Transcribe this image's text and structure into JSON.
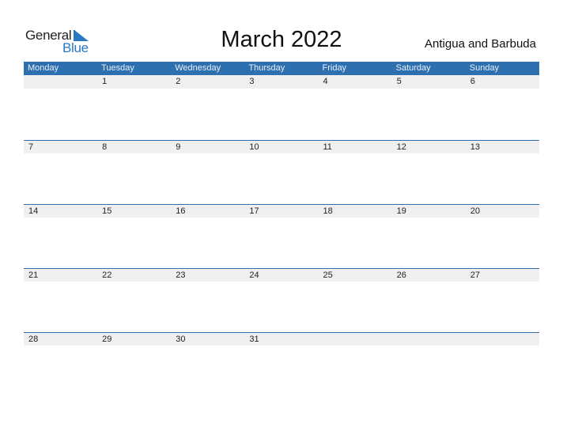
{
  "logo": {
    "general": "General",
    "blue": "Blue"
  },
  "title": "March 2022",
  "country": "Antigua and Barbuda",
  "colors": {
    "accent": "#2e6fb0",
    "band": "#f0f0f0"
  },
  "weekdays": [
    "Monday",
    "Tuesday",
    "Wednesday",
    "Thursday",
    "Friday",
    "Saturday",
    "Sunday"
  ],
  "weeks": [
    [
      "",
      "1",
      "2",
      "3",
      "4",
      "5",
      "6"
    ],
    [
      "7",
      "8",
      "9",
      "10",
      "11",
      "12",
      "13"
    ],
    [
      "14",
      "15",
      "16",
      "17",
      "18",
      "19",
      "20"
    ],
    [
      "21",
      "22",
      "23",
      "24",
      "25",
      "26",
      "27"
    ],
    [
      "28",
      "29",
      "30",
      "31",
      "",
      "",
      ""
    ]
  ]
}
